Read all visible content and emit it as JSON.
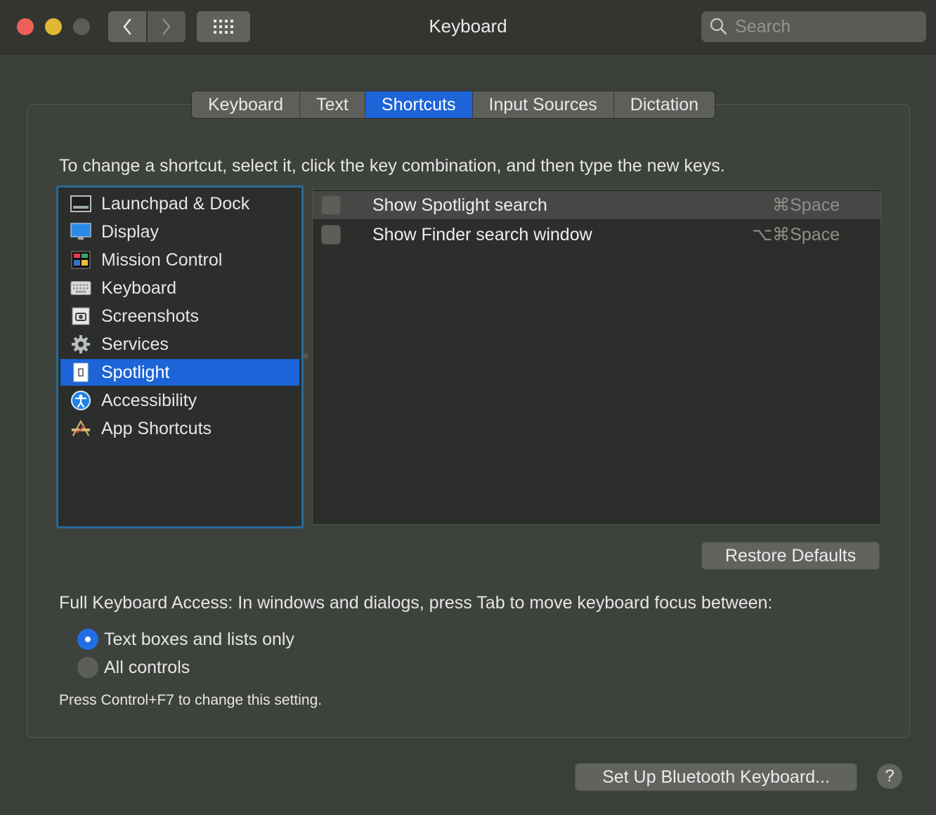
{
  "window": {
    "title": "Keyboard",
    "search_placeholder": "Search"
  },
  "tabs": [
    {
      "label": "Keyboard",
      "active": false
    },
    {
      "label": "Text",
      "active": false
    },
    {
      "label": "Shortcuts",
      "active": true
    },
    {
      "label": "Input Sources",
      "active": false
    },
    {
      "label": "Dictation",
      "active": false
    }
  ],
  "instruction": "To change a shortcut, select it, click the key combination, and then type the new keys.",
  "categories": [
    {
      "label": "Launchpad & Dock",
      "icon": "launchpad-dock-icon"
    },
    {
      "label": "Display",
      "icon": "display-icon"
    },
    {
      "label": "Mission Control",
      "icon": "mission-control-icon"
    },
    {
      "label": "Keyboard",
      "icon": "keyboard-icon"
    },
    {
      "label": "Screenshots",
      "icon": "screenshots-icon"
    },
    {
      "label": "Services",
      "icon": "gear-icon"
    },
    {
      "label": "Spotlight",
      "icon": "spotlight-icon",
      "selected": true
    },
    {
      "label": "Accessibility",
      "icon": "accessibility-icon"
    },
    {
      "label": "App Shortcuts",
      "icon": "app-shortcuts-icon"
    }
  ],
  "shortcuts": [
    {
      "label": "Show Spotlight search",
      "key": "⌘Space",
      "checked": false
    },
    {
      "label": "Show Finder search window",
      "key": "⌥⌘Space",
      "checked": false
    }
  ],
  "restore_defaults": "Restore Defaults",
  "full_keyboard_access": {
    "label": "Full Keyboard Access: In windows and dialogs, press Tab to move keyboard focus between:",
    "options": [
      {
        "label": "Text boxes and lists only",
        "selected": true
      },
      {
        "label": "All controls",
        "selected": false
      }
    ],
    "hint": "Press Control+F7 to change this setting."
  },
  "bluetooth_button": "Set Up Bluetooth Keyboard...",
  "help_label": "?",
  "colors": {
    "accent": "#1c64d8",
    "focus_ring": "#2a6a96"
  }
}
